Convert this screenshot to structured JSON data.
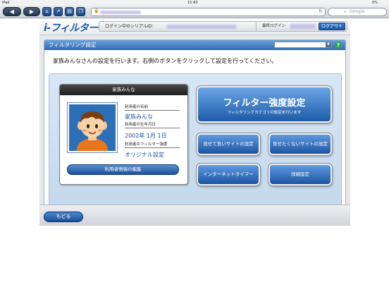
{
  "statusbar": {
    "carrier": "iPad",
    "time": "15:43",
    "battery": "0%"
  },
  "browser": {
    "search_placeholder": "Google"
  },
  "site": {
    "logo": "i-フィルター",
    "serial_label": "ログイン中のシリアルID：",
    "last_login_label": "最終ログイン",
    "logout": "ログアウト"
  },
  "panel": {
    "title": "フィルタリング設定",
    "instruction": "家族みんなさんの設定を行います。右側のボタンをクリックして設定を行ってください。"
  },
  "profile": {
    "card_title": "家族みんな",
    "name_label": "利用者の名前",
    "name_value": "家族みんな",
    "birth_label": "利用者の生年月日",
    "birth_value": "2002年 1月 1日",
    "strength_label": "利用者のフィルター強度",
    "strength_value": "オリジナル設定",
    "edit_button": "利用者情報の編集"
  },
  "actions": {
    "strength_title": "フィルター強度設定",
    "strength_sub": "フィルタリングカテゴリの設定を行います",
    "good_sites": "見せて良いサイトの設定",
    "bad_sites": "見せたくないサイトの設定",
    "timer": "インターネットタイマー",
    "details": "詳細設定"
  },
  "footer": {
    "back": "もどる"
  }
}
